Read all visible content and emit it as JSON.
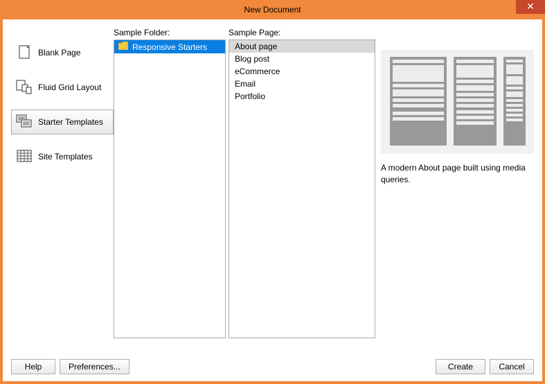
{
  "title": "New Document",
  "sidebar": {
    "items": [
      {
        "label": "Blank Page"
      },
      {
        "label": "Fluid Grid Layout"
      },
      {
        "label": "Starter Templates"
      },
      {
        "label": "Site Templates"
      }
    ]
  },
  "folder": {
    "label": "Sample Folder:",
    "items": [
      {
        "label": "Responsive Starters"
      }
    ]
  },
  "page": {
    "label": "Sample Page:",
    "items": [
      {
        "label": "About page"
      },
      {
        "label": "Blog post"
      },
      {
        "label": "eCommerce"
      },
      {
        "label": "Email"
      },
      {
        "label": "Portfolio"
      }
    ]
  },
  "preview": {
    "description": "A modern About page built using media queries."
  },
  "footer": {
    "help": "Help",
    "preferences": "Preferences...",
    "create": "Create",
    "cancel": "Cancel"
  }
}
